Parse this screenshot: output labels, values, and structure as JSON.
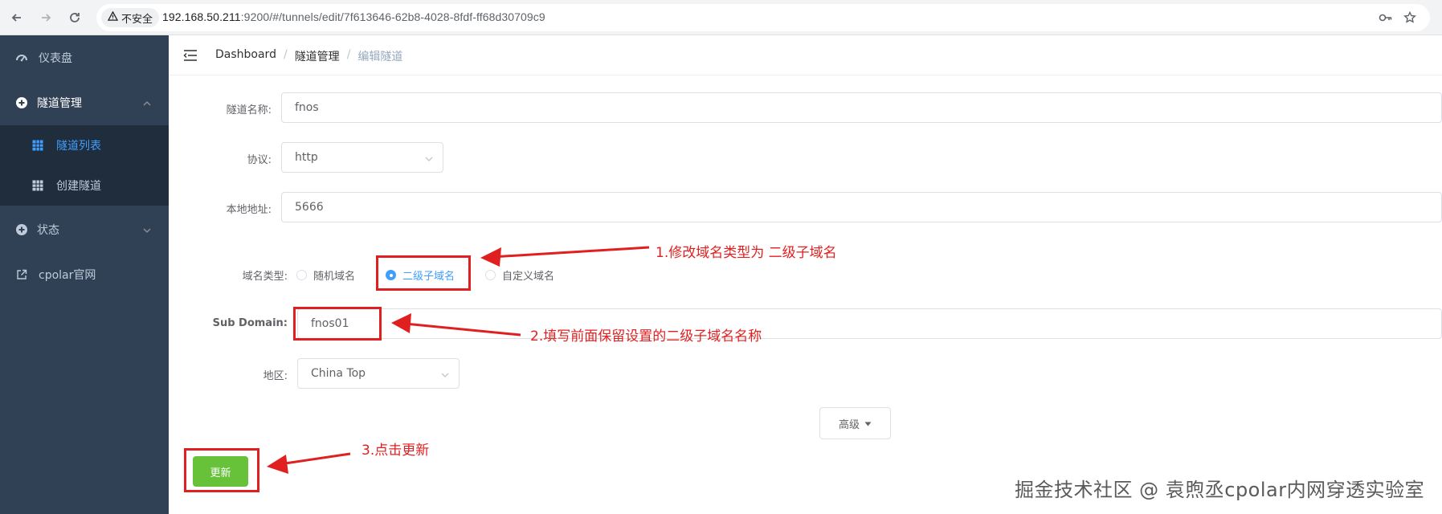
{
  "browser": {
    "security_label": "不安全",
    "url_host": "192.168.50.211",
    "url_path": ":9200/#/tunnels/edit/7f613646-62b8-4028-8fdf-ff68d30709c9"
  },
  "sidebar": {
    "items": [
      {
        "label": "仪表盘",
        "icon": "dashboard-icon"
      },
      {
        "label": "隧道管理",
        "icon": "tunnel-icon",
        "expanded": true
      },
      {
        "label": "状态",
        "icon": "status-icon"
      },
      {
        "label": "cpolar官网",
        "icon": "external-link-icon"
      }
    ],
    "submenu": [
      {
        "label": "隧道列表",
        "icon": "grid-icon",
        "active": true
      },
      {
        "label": "创建隧道",
        "icon": "grid-icon"
      }
    ]
  },
  "breadcrumb": [
    "Dashboard",
    "隧道管理",
    "编辑隧道"
  ],
  "form": {
    "name_label": "隧道名称:",
    "name_value": "fnos",
    "protocol_label": "协议:",
    "protocol_value": "http",
    "local_label": "本地地址:",
    "local_value": "5666",
    "domain_type_label": "域名类型:",
    "domain_options": [
      "随机域名",
      "二级子域名",
      "自定义域名"
    ],
    "domain_selected": "二级子域名",
    "subdomain_label": "Sub Domain:",
    "subdomain_value": "fnos01",
    "region_label": "地区:",
    "region_value": "China Top",
    "advanced_label": "高级",
    "update_label": "更新"
  },
  "annotations": [
    "1.修改域名类型为 二级子域名",
    "2.填写前面保留设置的二级子域名名称",
    "3.点击更新"
  ],
  "watermark": "掘金技术社区 @ 袁煦丞cpolar内网穿透实验室",
  "colors": {
    "sidebar_bg": "#304156",
    "submenu_bg": "#1f2d3d",
    "active": "#409eff",
    "success": "#67c23a",
    "annotation": "#e02020"
  }
}
